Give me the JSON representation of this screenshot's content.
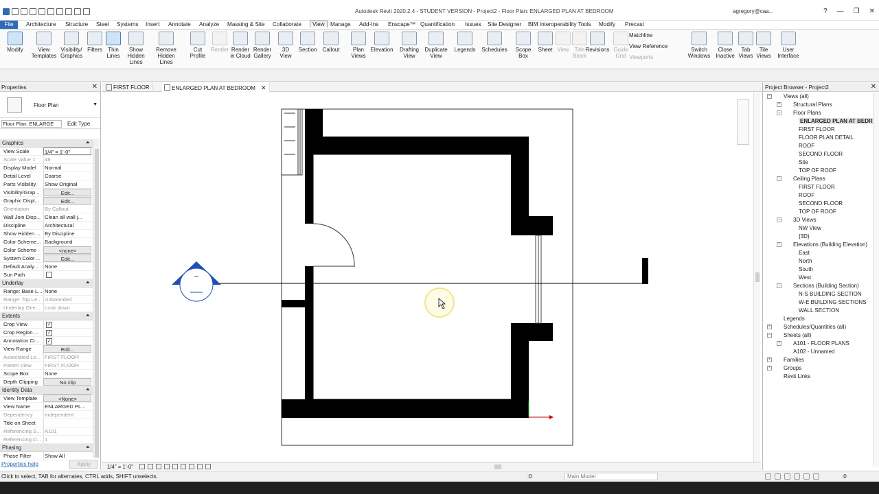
{
  "title_bar": {
    "app_title": "Autodesk Revit 2020.2.4 - STUDENT VERSION - Project2 - Floor Plan: ENLARGED PLAN AT BEDROOM",
    "user": "agregory@caa...",
    "help": "?",
    "min": "—",
    "max": "❐",
    "close": "✕"
  },
  "menu": {
    "file": "File",
    "items": [
      "Architecture",
      "Structure",
      "Steel",
      "Systems",
      "Insert",
      "Annotate",
      "Analyze",
      "Massing & Site",
      "Collaborate",
      "View",
      "Manage",
      "Add-Ins",
      "Enscape™",
      "Quantification",
      "Issues",
      "Site Designer",
      "BIM Interoperability Tools",
      "Modify",
      "Precast"
    ],
    "active": "View"
  },
  "ribbon": {
    "buttons": [
      {
        "label": "Modify",
        "state": "sel"
      },
      {
        "label": "View\nTemplates",
        "state": ""
      },
      {
        "label": "Visibility/\nGraphics",
        "state": ""
      },
      {
        "label": "Filters",
        "state": ""
      },
      {
        "label": "Thin\nLines",
        "state": "sel"
      },
      {
        "label": "Show\nHidden Lines",
        "state": ""
      },
      {
        "label": "Remove\nHidden Lines",
        "state": ""
      },
      {
        "label": "Cut\nProfile",
        "state": ""
      },
      {
        "label": "Render",
        "state": "dis"
      },
      {
        "label": "Render\nin Cloud",
        "state": ""
      },
      {
        "label": "Render\nGallery",
        "state": ""
      },
      {
        "label": "3D\nView",
        "state": ""
      },
      {
        "label": "Section",
        "state": ""
      },
      {
        "label": "Callout",
        "state": ""
      },
      {
        "label": "Plan\nViews",
        "state": ""
      },
      {
        "label": "Elevation",
        "state": ""
      },
      {
        "label": "Drafting\nView",
        "state": ""
      },
      {
        "label": "Duplicate\nView",
        "state": ""
      },
      {
        "label": "Legends",
        "state": ""
      },
      {
        "label": "Schedules",
        "state": ""
      },
      {
        "label": "Scope\nBox",
        "state": ""
      },
      {
        "label": "Sheet",
        "state": ""
      },
      {
        "label": "View",
        "state": "dis"
      },
      {
        "label": "Title\nBlock",
        "state": "dis"
      },
      {
        "label": "Revisions",
        "state": ""
      },
      {
        "label": "Guide\nGrid",
        "state": "dis"
      },
      {
        "label": "Switch\nWindows",
        "state": ""
      },
      {
        "label": "Close\nInactive",
        "state": ""
      },
      {
        "label": "Tab\nViews",
        "state": ""
      },
      {
        "label": "Tile\nViews",
        "state": ""
      },
      {
        "label": "User\nInterface",
        "state": ""
      }
    ],
    "small": {
      "matchline": "Matchline",
      "view_reference": "View  Reference",
      "viewports": "Viewports"
    }
  },
  "properties": {
    "title": "Properties",
    "type_name": "Floor Plan",
    "instance_selector": "Floor Plan: ENLARGE",
    "edit_type": "Edit Type",
    "rows": [
      {
        "g": "Graphics"
      },
      {
        "k": "View Scale",
        "v": "1/4\" = 1'-0\"",
        "t": "box"
      },
      {
        "k": "Scale Value 1:",
        "v": "48",
        "dim": true
      },
      {
        "k": "Display Model",
        "v": "Normal"
      },
      {
        "k": "Detail Level",
        "v": "Coarse"
      },
      {
        "k": "Parts Visibility",
        "v": "Show Original"
      },
      {
        "k": "Visibility/Grap...",
        "v": "Edit...",
        "t": "btn"
      },
      {
        "k": "Graphic Displ...",
        "v": "Edit...",
        "t": "btn"
      },
      {
        "k": "Orientation",
        "v": "By Callout",
        "dim": true
      },
      {
        "k": "Wall Join Disp...",
        "v": "Clean all wall j..."
      },
      {
        "k": "Discipline",
        "v": "Architectural"
      },
      {
        "k": "Show Hidden ...",
        "v": "By Discipline"
      },
      {
        "k": "Color Scheme...",
        "v": "Background"
      },
      {
        "k": "Color Scheme",
        "v": "<none>",
        "t": "btn"
      },
      {
        "k": "System Color ...",
        "v": "Edit...",
        "t": "btn"
      },
      {
        "k": "Default Analy...",
        "v": "None"
      },
      {
        "k": "Sun Path",
        "v": "",
        "t": "chk"
      },
      {
        "g": "Underlay"
      },
      {
        "k": "Range: Base L...",
        "v": "None"
      },
      {
        "k": "Range: Top Le...",
        "v": "Unbounded",
        "dim": true
      },
      {
        "k": "Underlay Orie...",
        "v": "Look down",
        "dim": true
      },
      {
        "g": "Extents"
      },
      {
        "k": "Crop View",
        "v": "",
        "t": "chk on"
      },
      {
        "k": "Crop Region ...",
        "v": "",
        "t": "chk on"
      },
      {
        "k": "Annotation Cr...",
        "v": "",
        "t": "chk on"
      },
      {
        "k": "View Range",
        "v": "Edit...",
        "t": "btn"
      },
      {
        "k": "Associated Le...",
        "v": "FIRST FLOOR",
        "dim": true
      },
      {
        "k": "Parent View",
        "v": "FIRST FLOOR",
        "dim": true
      },
      {
        "k": "Scope Box",
        "v": "None"
      },
      {
        "k": "Depth Clipping",
        "v": "No clip",
        "t": "btn"
      },
      {
        "g": "Identity Data"
      },
      {
        "k": "View Template",
        "v": "<None>",
        "t": "btn"
      },
      {
        "k": "View Name",
        "v": "ENLARGED PL..."
      },
      {
        "k": "Dependency",
        "v": "Independent",
        "dim": true
      },
      {
        "k": "Title on Sheet",
        "v": ""
      },
      {
        "k": "Referencing S...",
        "v": "A101",
        "dim": true
      },
      {
        "k": "Referencing D...",
        "v": "1",
        "dim": true
      },
      {
        "g": "Phasing"
      },
      {
        "k": "Phase Filter",
        "v": "Show All"
      }
    ],
    "help_link": "Properties help",
    "apply": "Apply"
  },
  "tabs": [
    {
      "label": "FIRST FLOOR",
      "active": false
    },
    {
      "label": "ENLARGED PLAN AT BEDROOM",
      "active": true
    }
  ],
  "tab_close": "✕",
  "view_control": {
    "scale": "1/4\" = 1'-0\""
  },
  "browser": {
    "title": "Project Browser - Project2",
    "items": [
      {
        "d": 0,
        "t": "-",
        "l": "Views (all)"
      },
      {
        "d": 1,
        "t": "+",
        "l": "Structural Plans"
      },
      {
        "d": 1,
        "t": "-",
        "l": "Floor Plans"
      },
      {
        "d": 2,
        "t": "",
        "l": "ENLARGED PLAN AT BEDROOM",
        "sel": true
      },
      {
        "d": 2,
        "t": "",
        "l": "FIRST FLOOR"
      },
      {
        "d": 2,
        "t": "",
        "l": "FLOOR PLAN DETAIL"
      },
      {
        "d": 2,
        "t": "",
        "l": "ROOF"
      },
      {
        "d": 2,
        "t": "",
        "l": "SECOND FLOOR"
      },
      {
        "d": 2,
        "t": "",
        "l": "Site"
      },
      {
        "d": 2,
        "t": "",
        "l": "TOP OF ROOF"
      },
      {
        "d": 1,
        "t": "-",
        "l": "Ceiling Plans"
      },
      {
        "d": 2,
        "t": "",
        "l": "FIRST FLOOR"
      },
      {
        "d": 2,
        "t": "",
        "l": "ROOF"
      },
      {
        "d": 2,
        "t": "",
        "l": "SECOND FLOOR"
      },
      {
        "d": 2,
        "t": "",
        "l": "TOP OF ROOF"
      },
      {
        "d": 1,
        "t": "-",
        "l": "3D Views"
      },
      {
        "d": 2,
        "t": "",
        "l": "NW View"
      },
      {
        "d": 2,
        "t": "",
        "l": "{3D}"
      },
      {
        "d": 1,
        "t": "-",
        "l": "Elevations (Building Elevation)"
      },
      {
        "d": 2,
        "t": "",
        "l": "East"
      },
      {
        "d": 2,
        "t": "",
        "l": "North"
      },
      {
        "d": 2,
        "t": "",
        "l": "South"
      },
      {
        "d": 2,
        "t": "",
        "l": "West"
      },
      {
        "d": 1,
        "t": "-",
        "l": "Sections (Building Section)"
      },
      {
        "d": 2,
        "t": "",
        "l": "N-S BUILDING SECTION"
      },
      {
        "d": 2,
        "t": "",
        "l": "W-E BUILDING SECTIONS"
      },
      {
        "d": 2,
        "t": "",
        "l": "WALL SECTION"
      },
      {
        "d": 0,
        "t": "",
        "l": "Legends"
      },
      {
        "d": 0,
        "t": "+",
        "l": "Schedules/Quantities (all)"
      },
      {
        "d": 0,
        "t": "-",
        "l": "Sheets (all)"
      },
      {
        "d": 1,
        "t": "+",
        "l": "A101 - FLOOR PLANS"
      },
      {
        "d": 1,
        "t": "",
        "l": "A102 - Unnamed"
      },
      {
        "d": 0,
        "t": "+",
        "l": "Families"
      },
      {
        "d": 0,
        "t": "+",
        "l": "Groups"
      },
      {
        "d": 0,
        "t": "",
        "l": "Revit Links"
      }
    ]
  },
  "status": {
    "message": "Click to select, TAB for alternates, CTRL adds, SHIFT unselects.",
    "zero": ":0",
    "model": "Main Model",
    "right_zero": ":0"
  },
  "colors": {
    "accent": "#2e6db4",
    "elevation_marker": "#1f4fb4"
  }
}
